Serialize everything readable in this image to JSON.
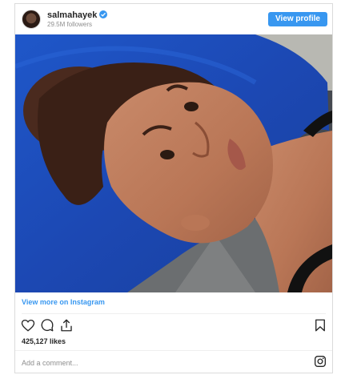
{
  "post": {
    "username": "salmahayek",
    "followers": "29.5M followers",
    "view_profile_label": "View profile",
    "view_more_label": "View more on Instagram",
    "likes": "425,127 likes",
    "comment_placeholder": "Add a comment..."
  },
  "icons": {
    "verified": "verified-badge-icon",
    "like": "heart-icon",
    "comment": "comment-bubble-icon",
    "share": "share-icon",
    "save": "bookmark-icon",
    "instagram": "instagram-logo-icon"
  },
  "colors": {
    "accent": "#3897f0",
    "text": "#262626",
    "muted": "#8e8e8e",
    "border": "#dbdbdb"
  }
}
